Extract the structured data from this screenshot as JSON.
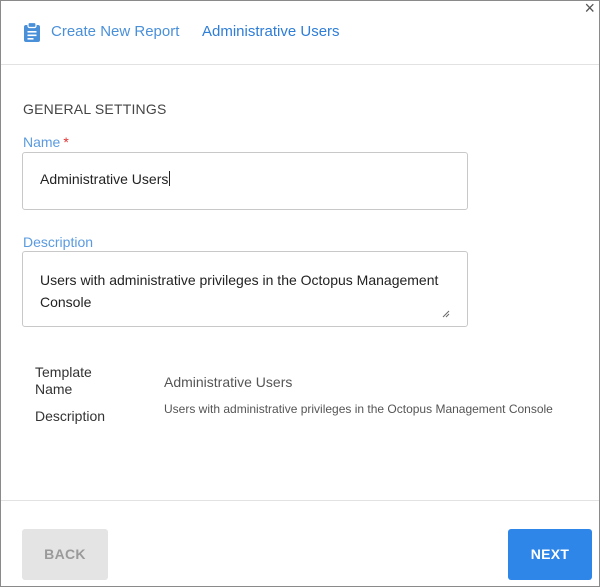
{
  "window": {
    "close_glyph": "×"
  },
  "breadcrumb": {
    "items": [
      {
        "label": "Create New Report"
      },
      {
        "label": "Administrative Users"
      }
    ],
    "icon": "clipboard-icon"
  },
  "general_settings": {
    "section_title": "GENERAL SETTINGS",
    "name_label": "Name",
    "required_marker": "*",
    "name_value": "Administrative Users",
    "description_label": "Description",
    "description_value": "Users with administrative privileges in the Octopus Management Console"
  },
  "template_info": {
    "template_name_key": "Template Name",
    "template_name_value": "Administrative Users",
    "description_key": "Description",
    "description_value": "Users with administrative privileges in the Octopus Management Console"
  },
  "footer": {
    "back_label": "BACK",
    "next_label": "NEXT"
  },
  "colors": {
    "accent": "#2e86e8",
    "label_blue": "#5a9be0",
    "required_red": "#e03030",
    "disabled_gray": "#e4e4e4"
  }
}
